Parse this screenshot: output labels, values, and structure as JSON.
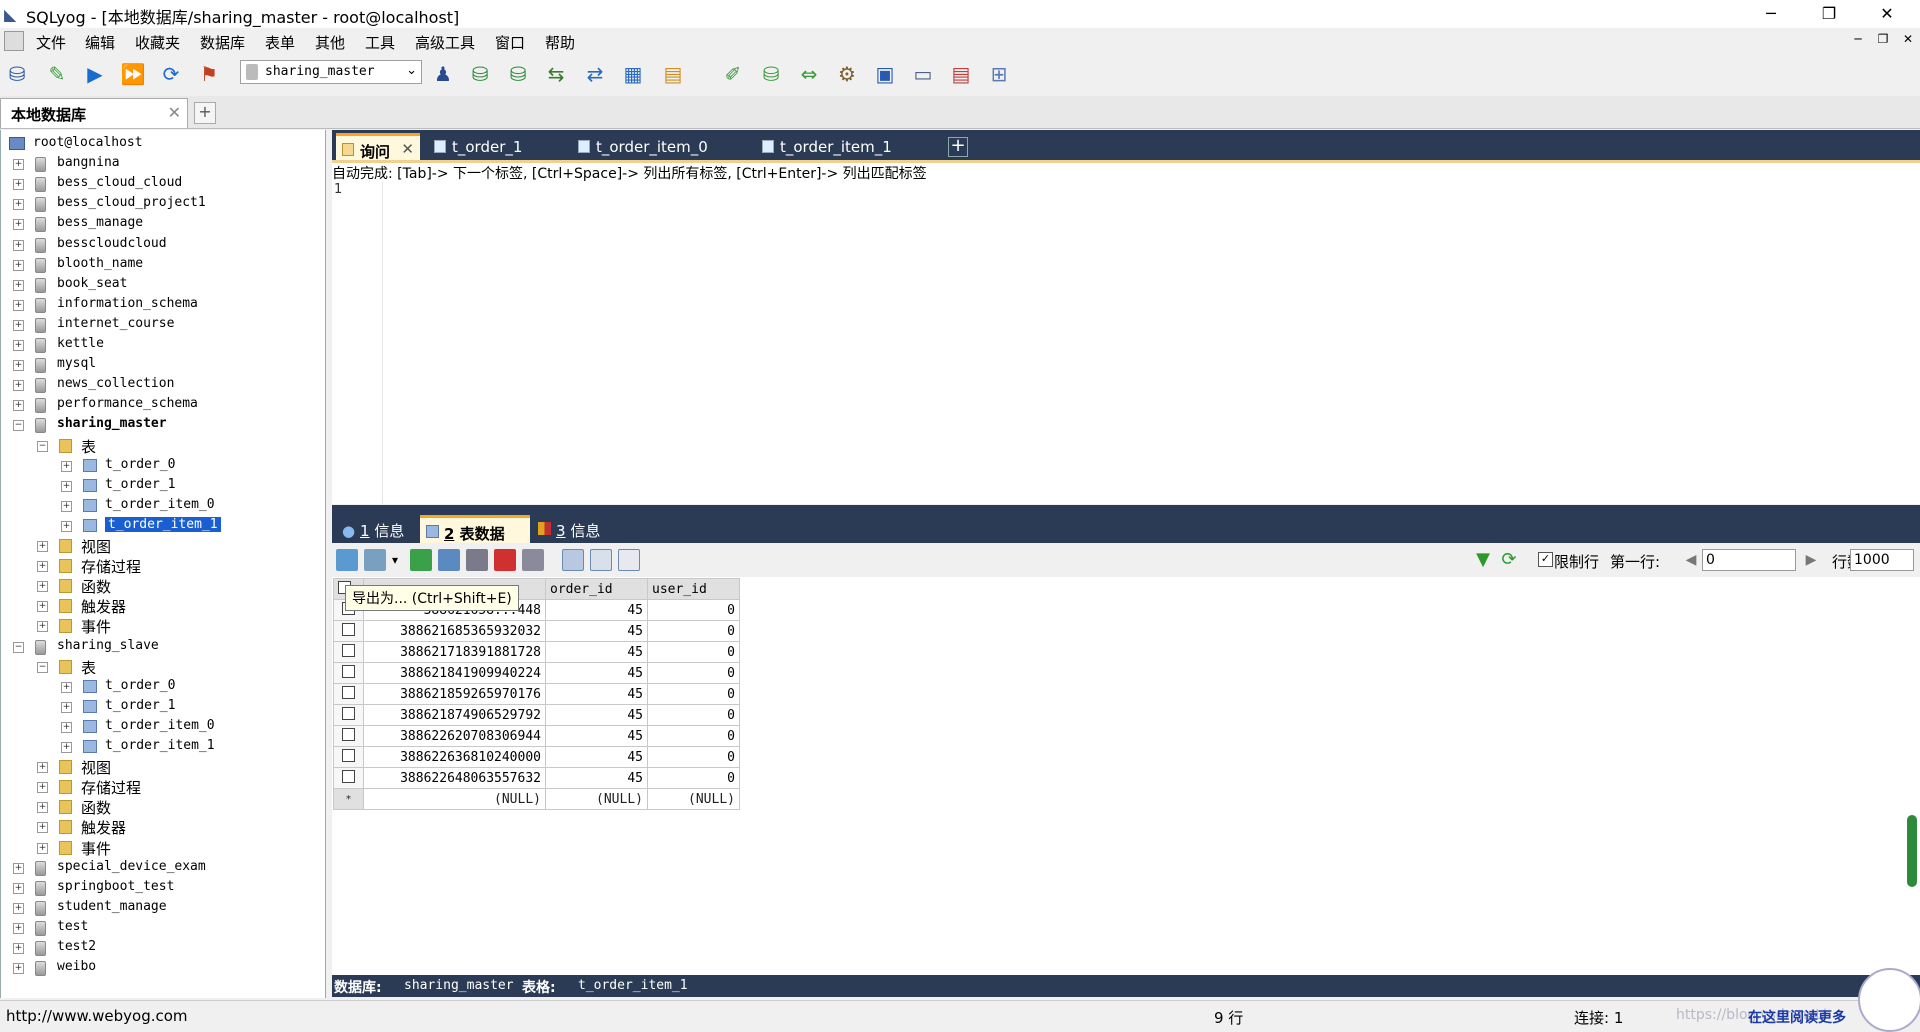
{
  "window": {
    "title": "SQLyog - [本地数据库/sharing_master - root@localhost]"
  },
  "menu": [
    "文件",
    "编辑",
    "收藏夹",
    "数据库",
    "表单",
    "其他",
    "工具",
    "高级工具",
    "窗口",
    "帮助"
  ],
  "toolbar": {
    "database_selected": "sharing_master"
  },
  "connection_tab": {
    "label": "本地数据库"
  },
  "tree": {
    "root": "root@localhost",
    "databases": [
      "bangnina",
      "bess_cloud_cloud",
      "bess_cloud_project1",
      "bess_manage",
      "besscloudcloud",
      "blooth_name",
      "book_seat",
      "information_schema",
      "internet_course",
      "kettle",
      "mysql",
      "news_collection",
      "performance_schema",
      "sharing_master",
      "sharing_slave",
      "special_device_exam",
      "springboot_test",
      "student_manage",
      "test",
      "test2",
      "weibo"
    ],
    "folder_tables": "表",
    "folder_views": "视图",
    "folder_procs": "存储过程",
    "folder_funcs": "函数",
    "folder_triggers": "触发器",
    "folder_events": "事件",
    "master_tables": [
      "t_order_0",
      "t_order_1",
      "t_order_item_0",
      "t_order_item_1"
    ],
    "slave_tables": [
      "t_order_0",
      "t_order_1",
      "t_order_item_0",
      "t_order_item_1"
    ],
    "selected_table": "t_order_item_1"
  },
  "query_tabs": [
    {
      "label": "询问"
    },
    {
      "label": "t_order_1"
    },
    {
      "label": "t_order_item_0"
    },
    {
      "label": "t_order_item_1"
    }
  ],
  "editor": {
    "autocomplete_hint": "自动完成: [Tab]-> 下一个标签, [Ctrl+Space]-> 列出所有标签, [Ctrl+Enter]-> 列出匹配标签",
    "line_number": "1"
  },
  "result_tabs": [
    {
      "num": "1",
      "label": "信息"
    },
    {
      "num": "2",
      "label": "表数据"
    },
    {
      "num": "3",
      "label": "信息"
    }
  ],
  "result_toolbar": {
    "limit_label": "限制行",
    "first_row_label": "第一行:",
    "first_row_value": "0",
    "rows_label": "行数:",
    "rows_value": "1000"
  },
  "grid": {
    "columns": [
      "order_id",
      "user_id"
    ],
    "rows": [
      {
        "id": "388621658...448",
        "order_id": "45",
        "user_id": "0"
      },
      {
        "id": "388621685365932032",
        "order_id": "45",
        "user_id": "0"
      },
      {
        "id": "388621718391881728",
        "order_id": "45",
        "user_id": "0"
      },
      {
        "id": "388621841909940224",
        "order_id": "45",
        "user_id": "0"
      },
      {
        "id": "388621859265970176",
        "order_id": "45",
        "user_id": "0"
      },
      {
        "id": "388621874906529792",
        "order_id": "45",
        "user_id": "0"
      },
      {
        "id": "388622620708306944",
        "order_id": "45",
        "user_id": "0"
      },
      {
        "id": "388622636810240000",
        "order_id": "45",
        "user_id": "0"
      },
      {
        "id": "388622648063557632",
        "order_id": "45",
        "user_id": "0"
      }
    ],
    "null_row": [
      "(NULL)",
      "(NULL)",
      "(NULL)"
    ],
    "tooltip": "导出为... (Ctrl+Shift+E)"
  },
  "infobar": {
    "db_label": "数据库:",
    "db_value": "sharing_master",
    "table_label": "表格:",
    "table_value": "t_order_item_1"
  },
  "status": {
    "url": "http://www.webyog.com",
    "rows": "9 行",
    "connections": "连接: 1",
    "watermark": "https://blog.csdn.net/",
    "ad": "在这里阅读更多"
  },
  "colors": {
    "dark_tab": "#2b3a55",
    "active_accent": "#f5a623",
    "selection": "#1a5fd1"
  }
}
